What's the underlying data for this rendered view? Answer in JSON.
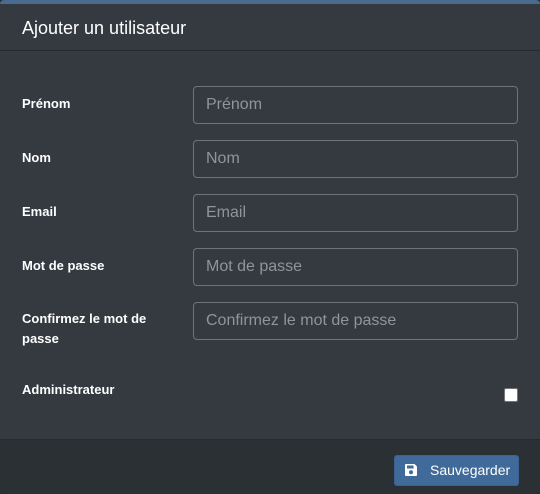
{
  "modal": {
    "title": "Ajouter un utilisateur"
  },
  "form": {
    "fields": [
      {
        "label": "Prénom",
        "placeholder": "Prénom",
        "value": ""
      },
      {
        "label": "Nom",
        "placeholder": "Nom",
        "value": ""
      },
      {
        "label": "Email",
        "placeholder": "Email",
        "value": ""
      },
      {
        "label": "Mot de passe",
        "placeholder": "Mot de passe",
        "value": ""
      },
      {
        "label": "Confirmez le mot de passe",
        "placeholder": "Confirmez le mot de passe",
        "value": ""
      }
    ],
    "admin": {
      "label": "Administrateur",
      "checked": false
    }
  },
  "footer": {
    "save_label": "Sauvegarder",
    "save_icon": "floppy-disk-icon"
  },
  "colors": {
    "background": "#343a40",
    "footer": "#2b3035",
    "accent": "#3f6a99",
    "input_border": "#6c757d"
  }
}
